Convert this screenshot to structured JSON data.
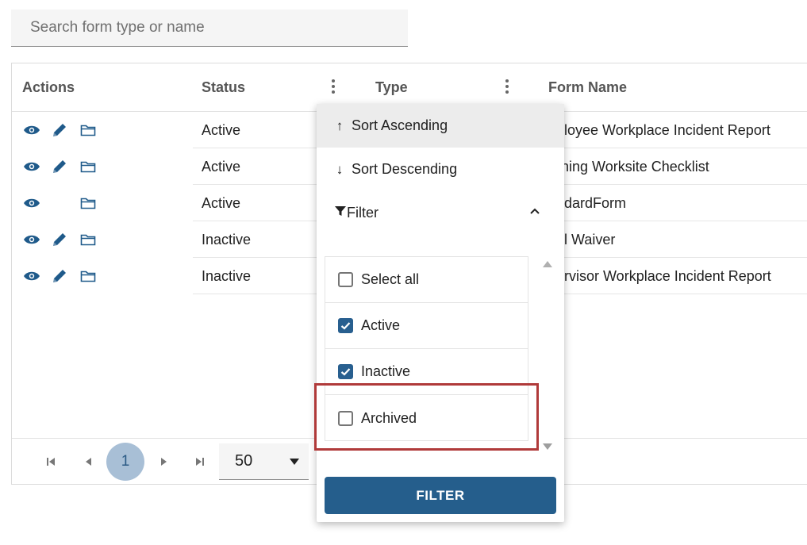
{
  "search": {
    "placeholder": "Search form type or name",
    "value": ""
  },
  "grid": {
    "columns": {
      "actions": "Actions",
      "status": "Status",
      "type": "Type",
      "form_name": "Form Name"
    },
    "rows": [
      {
        "status": "Active",
        "form_name": "nployee Workplace Incident Report",
        "has_edit": true
      },
      {
        "status": "Active",
        "form_name": "orning Worksite Checklist",
        "has_edit": true
      },
      {
        "status": "Active",
        "form_name": "andardForm",
        "has_edit": false
      },
      {
        "status": "Inactive",
        "form_name": "eal Waiver",
        "has_edit": true
      },
      {
        "status": "Inactive",
        "form_name": "pervisor Workplace Incident Report",
        "has_edit": true
      }
    ]
  },
  "pager": {
    "current_page": "1",
    "page_size": "50"
  },
  "column_menu": {
    "sort_ascending": "Sort Ascending",
    "sort_descending": "Sort Descending",
    "filter_label": "Filter",
    "options": [
      {
        "label": "Select all",
        "checked": false
      },
      {
        "label": "Active",
        "checked": true
      },
      {
        "label": "Inactive",
        "checked": true
      },
      {
        "label": "Archived",
        "checked": false
      }
    ],
    "filter_button": "FILTER"
  },
  "colors": {
    "primary": "#255e8c",
    "page_chip": "#a8bfd6",
    "highlight_box": "#b03a3a",
    "icon": "#1f5a8a"
  }
}
